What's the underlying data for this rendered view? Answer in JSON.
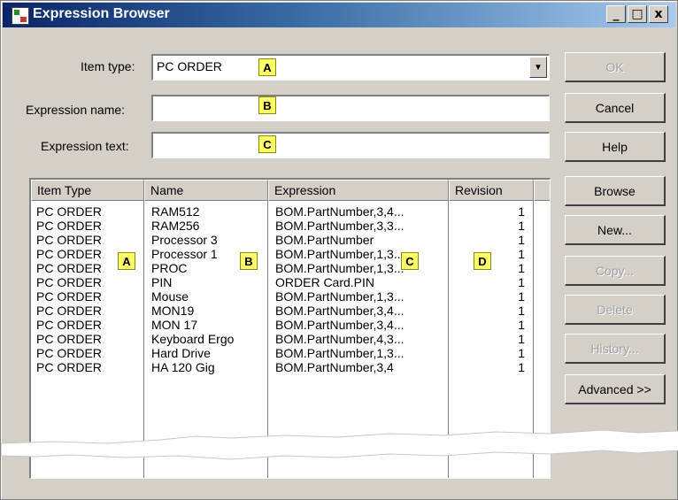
{
  "window": {
    "title": "Expression Browser"
  },
  "controls": {
    "minimize": "_",
    "maximize": "□",
    "close": "x"
  },
  "form": {
    "item_type_label": "Item type:",
    "item_type_value": "PC ORDER",
    "expression_name_label": "Expression name:",
    "expression_name_value": "",
    "expression_text_label": "Expression text:",
    "expression_text_value": ""
  },
  "callouts": {
    "a": "A",
    "b": "B",
    "c": "C",
    "d": "D"
  },
  "buttons": {
    "ok": "OK",
    "cancel": "Cancel",
    "help": "Help",
    "browse": "Browse",
    "new": "New...",
    "copy": "Copy...",
    "delete": "Delete",
    "history": "History...",
    "advanced": "Advanced >>"
  },
  "table": {
    "columns": [
      "Item Type",
      "Name",
      "Expression",
      "Revision"
    ],
    "rows": [
      [
        "PC ORDER",
        "RAM512",
        "BOM.PartNumber,3,4...",
        "1"
      ],
      [
        "PC ORDER",
        "RAM256",
        "BOM.PartNumber,3,3...",
        "1"
      ],
      [
        "PC ORDER",
        "Processor 3",
        "BOM.PartNumber",
        "1"
      ],
      [
        "PC ORDER",
        "Processor 1",
        "BOM.PartNumber,1,3...",
        "1"
      ],
      [
        "PC ORDER",
        "PROC",
        "BOM.PartNumber,1,3...",
        "1"
      ],
      [
        "PC ORDER",
        "PIN",
        "ORDER Card.PIN",
        "1"
      ],
      [
        "PC ORDER",
        "Mouse",
        "BOM.PartNumber,1,3...",
        "1"
      ],
      [
        "PC ORDER",
        "MON19",
        "BOM.PartNumber,3,4...",
        "1"
      ],
      [
        "PC ORDER",
        "MON 17",
        "BOM.PartNumber,3,4...",
        "1"
      ],
      [
        "PC ORDER",
        "Keyboard Ergo",
        "BOM.PartNumber,4,3...",
        "1"
      ],
      [
        "PC ORDER",
        "Hard Drive",
        "BOM.PartNumber,1,3...",
        "1"
      ],
      [
        "PC ORDER",
        "HA 120 Gig",
        "BOM.PartNumber,3,4",
        "1"
      ]
    ]
  }
}
